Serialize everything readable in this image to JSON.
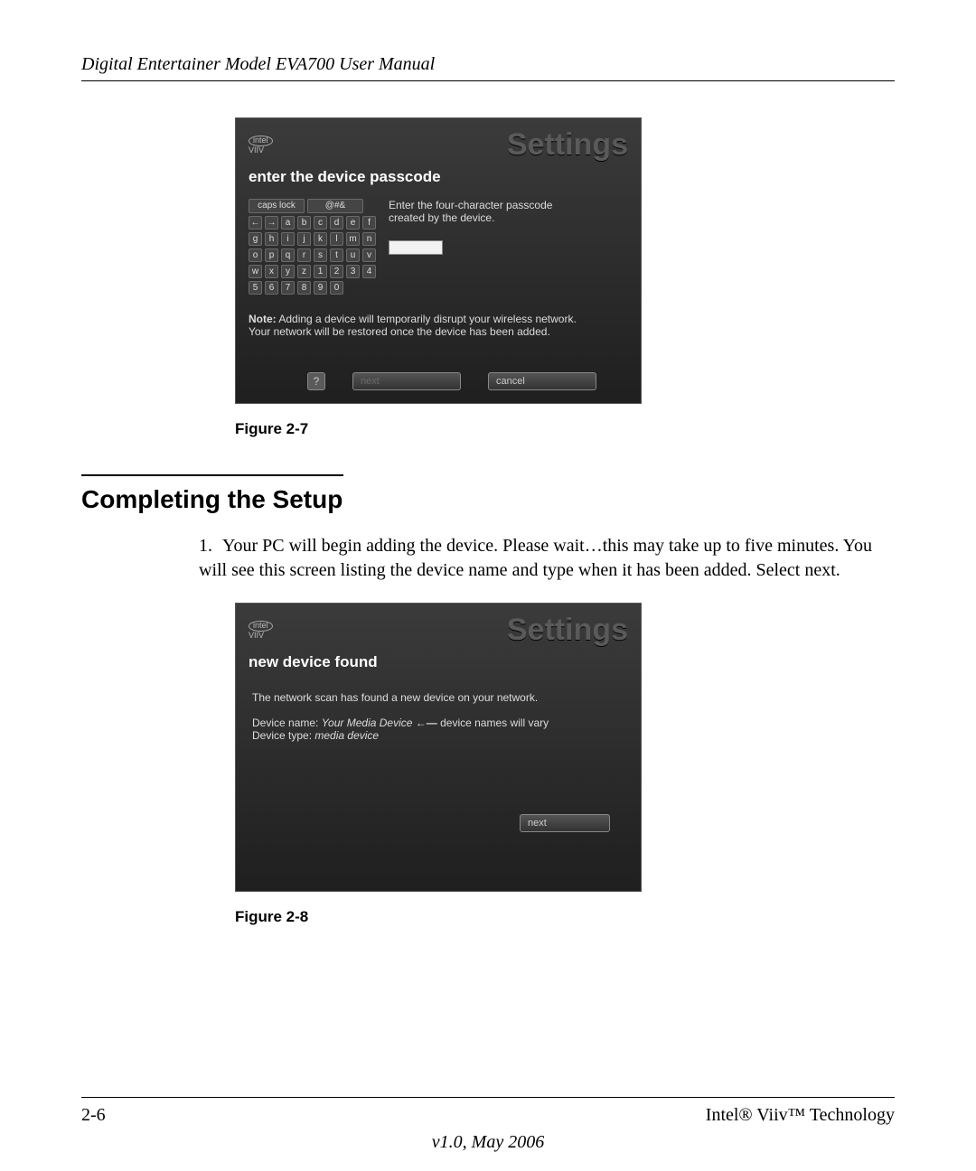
{
  "header": {
    "title": "Digital Entertainer Model EVA700 User Manual"
  },
  "figure1": {
    "logo_top": "intel",
    "logo_bottom": "VIIV",
    "settings_label": "Settings",
    "subtitle": "enter the device passcode",
    "caps_lock": "caps lock",
    "symbols": "@#&",
    "keys_row1": [
      "←",
      "→",
      "a",
      "b",
      "c",
      "d",
      "e",
      "f"
    ],
    "keys_row2": [
      "g",
      "h",
      "i",
      "j",
      "k",
      "l",
      "m",
      "n"
    ],
    "keys_row3": [
      "o",
      "p",
      "q",
      "r",
      "s",
      "t",
      "u",
      "v"
    ],
    "keys_row4": [
      "w",
      "x",
      "y",
      "z",
      "1",
      "2",
      "3",
      "4"
    ],
    "keys_row5": [
      "5",
      "6",
      "7",
      "8",
      "9",
      "0"
    ],
    "instruction1": "Enter the four-character passcode",
    "instruction2": "created by the device.",
    "note_bold": "Note:",
    "note_text1": " Adding a device will temporarily disrupt your wireless network.",
    "note_text2": "Your network will be restored once the device has been added.",
    "help": "?",
    "next": "next",
    "cancel": "cancel",
    "caption": "Figure 2-7"
  },
  "section": {
    "heading": "Completing the Setup",
    "list_num": "1.",
    "list_text": "Your PC will begin adding the device. Please wait…this may take up to five minutes. You will see this screen listing the device name and type when it has been added. Select next."
  },
  "figure2": {
    "logo_top": "intel",
    "logo_bottom": "VIIV",
    "settings_label": "Settings",
    "subtitle": "new device found",
    "line1": "The network scan has found a new device on your network.",
    "device_name_label": "Device name: ",
    "device_name_value": "Your Media Device",
    "arrow": " ←— ",
    "device_names_vary": "device names will vary",
    "device_type_label": "Device type: ",
    "device_type_value": "media device",
    "next": "next",
    "caption": "Figure 2-8"
  },
  "footer": {
    "page": "2-6",
    "tech": "Intel® Viiv™ Technology",
    "version": "v1.0, May 2006"
  }
}
